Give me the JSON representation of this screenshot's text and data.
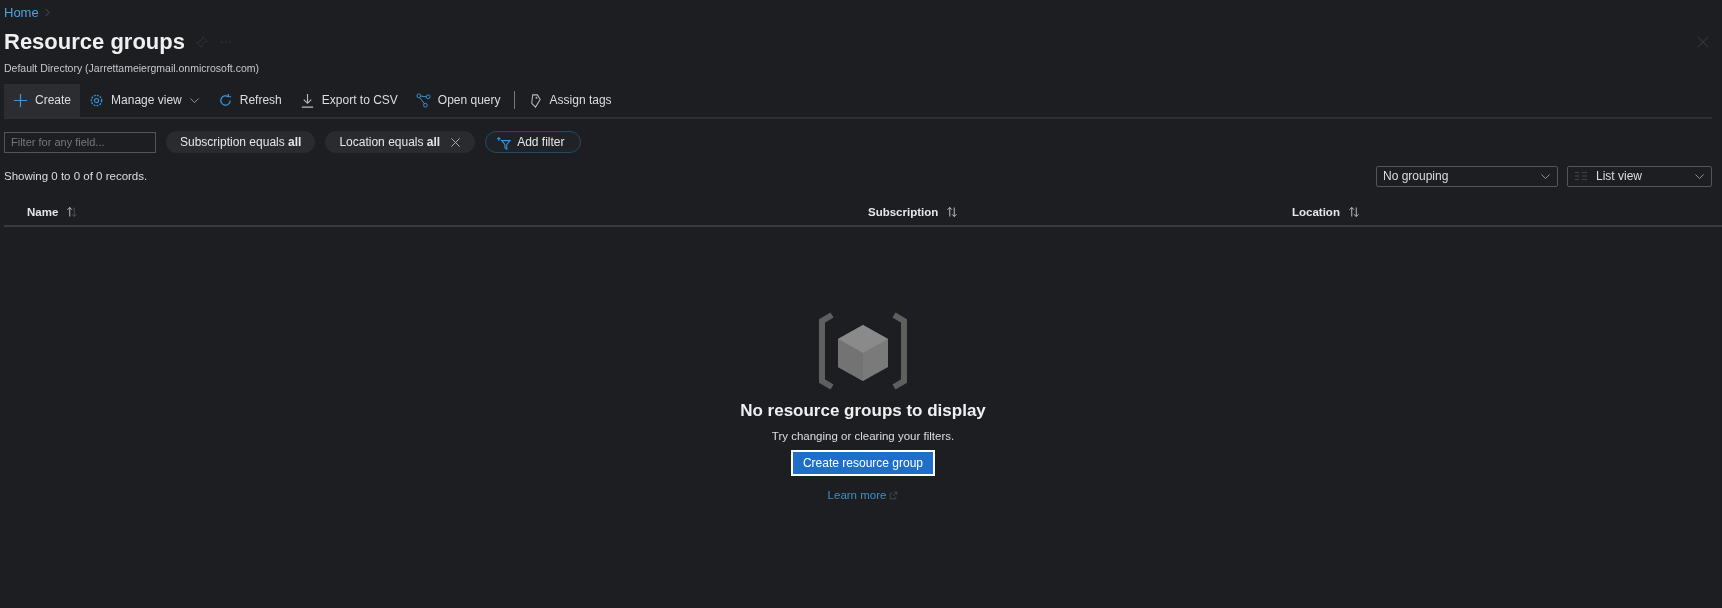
{
  "breadcrumb": [
    {
      "label": "Home"
    }
  ],
  "title": "Resource groups",
  "subtitle": "Default Directory (Jarrettameiergmail.onmicrosoft.com)",
  "toolbar": [
    {
      "kind": "button",
      "label": "Create",
      "hovered": true
    },
    {
      "kind": "button",
      "label": "Manage view",
      "hovered": false,
      "dropdown": true
    },
    {
      "kind": "button",
      "label": "Refresh",
      "hovered": false
    },
    {
      "kind": "button",
      "label": "Export to CSV",
      "hovered": false
    },
    {
      "kind": "button",
      "label": "Open query",
      "hovered": false
    },
    {
      "kind": "separator"
    },
    {
      "kind": "button",
      "label": "Assign tags",
      "hovered": false
    }
  ],
  "filter_field": {
    "placeholder": "Filter for any field..."
  },
  "filters": [
    {
      "text": "Subscription equals **all**",
      "removable": false
    },
    {
      "text": "Location equals **all**",
      "removable": true
    }
  ],
  "add_filter": "Add filter",
  "records": "Showing 0 to 0 of 0 records.",
  "grouping": {
    "value": "No grouping"
  },
  "view": {
    "value": "List view"
  },
  "columns": [
    {
      "label": "Name"
    },
    {
      "label": "Subscription"
    },
    {
      "label": "Location"
    }
  ],
  "empty_state": {
    "title": "No resource groups to display",
    "message": "Try changing or clearing your filters.",
    "button": "Create resource group",
    "link": "Learn more"
  }
}
